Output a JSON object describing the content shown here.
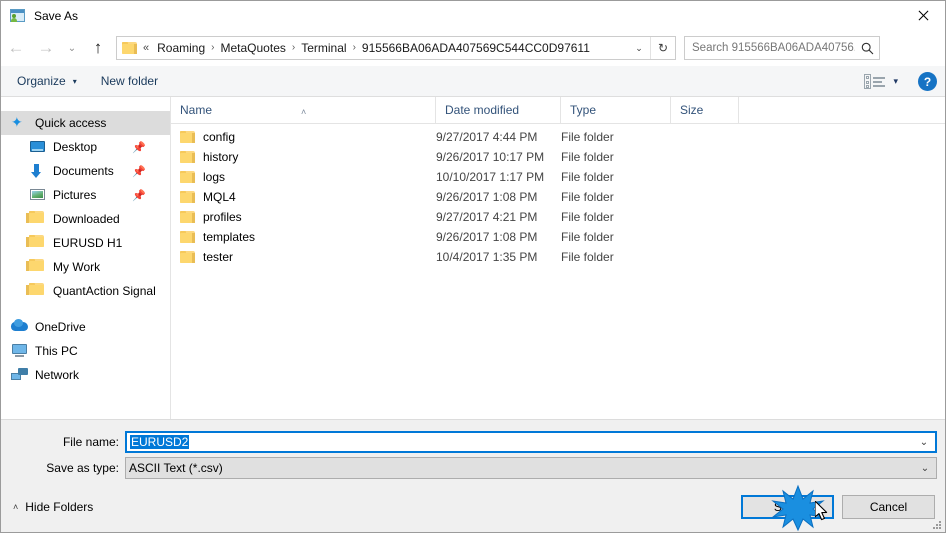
{
  "window": {
    "title": "Save As",
    "app_icon": "save-as-icon",
    "close_label": "✕"
  },
  "nav": {
    "back": "←",
    "forward": "→",
    "recent": "⌄",
    "up": "↑",
    "root_chevron": "«",
    "breadcrumbs": [
      "Roaming",
      "MetaQuotes",
      "Terminal",
      "915566BA06ADA407569C544CC0D97611"
    ],
    "separator": "›",
    "dropdown": "⌄",
    "refresh": "↻"
  },
  "search": {
    "placeholder": "Search 915566BA06ADA40756...",
    "icon": "search-icon"
  },
  "toolbar": {
    "organize": "Organize",
    "organize_caret": "▾",
    "new_folder": "New folder",
    "view_caret": "▾",
    "help": "?"
  },
  "sidebar": {
    "groups": [
      {
        "header": {
          "label": "Quick access",
          "icon": "star-icon",
          "selected": true
        },
        "items": [
          {
            "label": "Desktop",
            "icon": "desktop-icon",
            "pinned": true
          },
          {
            "label": "Documents",
            "icon": "download-icon",
            "pinned": true
          },
          {
            "label": "Pictures",
            "icon": "pictures-icon",
            "pinned": true
          },
          {
            "label": "Downloaded",
            "icon": "folder-icon",
            "pinned": false
          },
          {
            "label": "EURUSD H1",
            "icon": "folder-icon",
            "pinned": false
          },
          {
            "label": "My Work",
            "icon": "folder-icon",
            "pinned": false
          },
          {
            "label": "QuantAction Signal",
            "icon": "folder-icon",
            "pinned": false
          }
        ]
      }
    ],
    "roots": [
      {
        "label": "OneDrive",
        "icon": "onedrive-icon"
      },
      {
        "label": "This PC",
        "icon": "this-pc-icon"
      },
      {
        "label": "Network",
        "icon": "network-icon"
      }
    ]
  },
  "filelist": {
    "columns": [
      {
        "key": "name",
        "label": "Name",
        "sorted": "asc",
        "sort_caret": "˄"
      },
      {
        "key": "date",
        "label": "Date modified"
      },
      {
        "key": "type",
        "label": "Type"
      },
      {
        "key": "size",
        "label": "Size"
      }
    ],
    "rows": [
      {
        "name": "config",
        "date": "9/27/2017 4:44 PM",
        "type": "File folder",
        "size": ""
      },
      {
        "name": "history",
        "date": "9/26/2017 10:17 PM",
        "type": "File folder",
        "size": ""
      },
      {
        "name": "logs",
        "date": "10/10/2017 1:17 PM",
        "type": "File folder",
        "size": ""
      },
      {
        "name": "MQL4",
        "date": "9/26/2017 1:08 PM",
        "type": "File folder",
        "size": ""
      },
      {
        "name": "profiles",
        "date": "9/27/2017 4:21 PM",
        "type": "File folder",
        "size": ""
      },
      {
        "name": "templates",
        "date": "9/26/2017 1:08 PM",
        "type": "File folder",
        "size": ""
      },
      {
        "name": "tester",
        "date": "10/4/2017 1:35 PM",
        "type": "File folder",
        "size": ""
      }
    ]
  },
  "form": {
    "file_name_label": "File name:",
    "file_name_value": "EURUSD2",
    "save_as_type_label": "Save as type:",
    "save_as_type_value": "ASCII Text (*.csv)",
    "dropdown_glyph": "⌄"
  },
  "footer": {
    "hide_folders": "Hide Folders",
    "hide_folders_caret": "˄",
    "save": "Save",
    "cancel": "Cancel"
  },
  "colors": {
    "accent": "#0078d7",
    "selection": "#0078d7",
    "folder": "#fdd76e",
    "header_text": "#33537a",
    "help_blue": "#1673c4"
  }
}
